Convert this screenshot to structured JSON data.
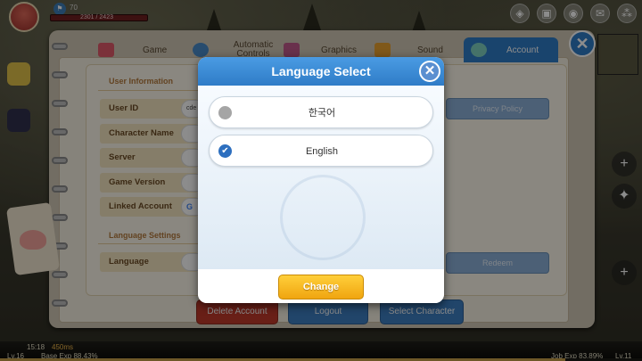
{
  "hud": {
    "level": "70",
    "hp": "2301 / 2423",
    "clock": "15:18",
    "ping": "450ms",
    "level_left": "Lv.16",
    "base_exp": "Base Exp 88.43%",
    "job_exp": "Job Exp 83.89%",
    "level_right": "Lv.11",
    "icons": [
      "gamepad-icon",
      "gift-icon",
      "chat-icon",
      "mail-icon",
      "grid-menu-icon"
    ]
  },
  "settings": {
    "tabs": [
      {
        "label": "Game",
        "icon": "gamepad-icon"
      },
      {
        "label": "Automatic Controls",
        "icon": "gear-icon"
      },
      {
        "label": "Graphics",
        "icon": "picture-icon"
      },
      {
        "label": "Sound",
        "icon": "speaker-icon"
      },
      {
        "label": "Account",
        "icon": "account-icon",
        "active": true
      }
    ],
    "user_info_title": "User Information",
    "rows": [
      {
        "label": "User ID",
        "value": "cde"
      },
      {
        "label": "Character Name",
        "value": ""
      },
      {
        "label": "Server",
        "value": ""
      },
      {
        "label": "Game Version",
        "value": ""
      },
      {
        "label": "Linked Account",
        "value": "G"
      }
    ],
    "language_settings_title": "Language Settings",
    "language_label": "Language",
    "privacy_policy": "Privacy Policy",
    "redeem": "Redeem",
    "delete_account": "Delete Account",
    "logout": "Logout",
    "select_character": "Select Character",
    "close": "✕"
  },
  "modal": {
    "title": "Language Select",
    "close": "✕",
    "options": [
      {
        "label": "한국어",
        "selected": false
      },
      {
        "label": "English",
        "selected": true
      }
    ],
    "checkmark": "✔",
    "change_button": "Change"
  },
  "colors": {
    "accent_blue": "#2f7cc7",
    "button_yellow": "#f0a510",
    "danger_red": "#c0392b"
  }
}
